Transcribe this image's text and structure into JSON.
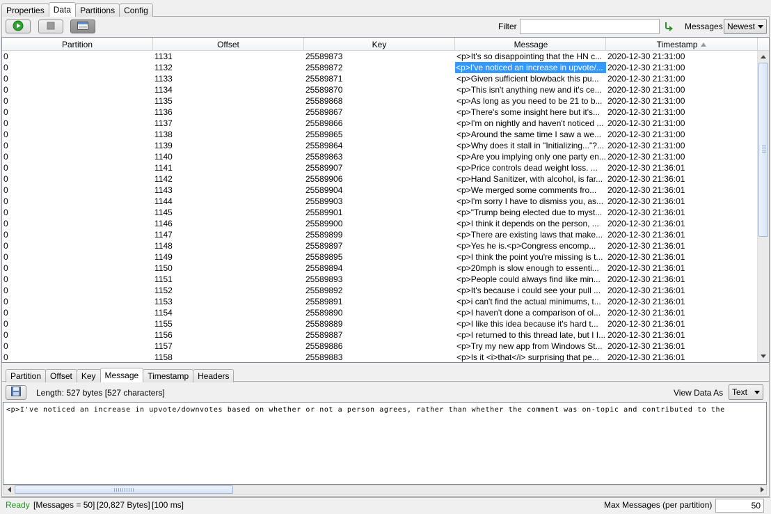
{
  "top_tabs": [
    "Properties",
    "Data",
    "Partitions",
    "Config"
  ],
  "toolbar": {
    "filter_label": "Filter",
    "filter_value": "",
    "messages_label": "Messages",
    "messages_value": "Newest"
  },
  "columns": [
    "Partition",
    "Offset",
    "Key",
    "Message",
    "Timestamp"
  ],
  "rows": [
    [
      "0",
      "1131",
      "25589873",
      "<p>It's so disappointing that the HN c...",
      "2020-12-30 21:31:00"
    ],
    [
      "0",
      "1132",
      "25589872",
      "<p>I've noticed an increase in upvote/...",
      "2020-12-30 21:31:00"
    ],
    [
      "0",
      "1133",
      "25589871",
      "<p>Given sufficient blowback this pu...",
      "2020-12-30 21:31:00"
    ],
    [
      "0",
      "1134",
      "25589870",
      "<p>This isn't anything new and it's ce...",
      "2020-12-30 21:31:00"
    ],
    [
      "0",
      "1135",
      "25589868",
      "<p>As long as you need to be 21 to b...",
      "2020-12-30 21:31:00"
    ],
    [
      "0",
      "1136",
      "25589867",
      "<p>There's some insight here but it's...",
      "2020-12-30 21:31:00"
    ],
    [
      "0",
      "1137",
      "25589866",
      "<p>I'm on nightly and haven't noticed ...",
      "2020-12-30 21:31:00"
    ],
    [
      "0",
      "1138",
      "25589865",
      "<p>Around the same time I saw a we...",
      "2020-12-30 21:31:00"
    ],
    [
      "0",
      "1139",
      "25589864",
      "<p>Why does it stall in \"Initializing...\"?...",
      "2020-12-30 21:31:00"
    ],
    [
      "0",
      "1140",
      "25589863",
      "<p>Are you implying only one party en...",
      "2020-12-30 21:31:00"
    ],
    [
      "0",
      "1141",
      "25589907",
      "<p>Price controls dead weight loss.  ...",
      "2020-12-30 21:36:01"
    ],
    [
      "0",
      "1142",
      "25589906",
      "<p>Hand Sanitizer, with alcohol, is far...",
      "2020-12-30 21:36:01"
    ],
    [
      "0",
      "1143",
      "25589904",
      "<p>We merged some comments fro...",
      "2020-12-30 21:36:01"
    ],
    [
      "0",
      "1144",
      "25589903",
      "<p>I'm sorry I have to dismiss you, as...",
      "2020-12-30 21:36:01"
    ],
    [
      "0",
      "1145",
      "25589901",
      "<p>\"Trump being elected due to myst...",
      "2020-12-30 21:36:01"
    ],
    [
      "0",
      "1146",
      "25589900",
      "<p>I think it depends on the person, ...",
      "2020-12-30 21:36:01"
    ],
    [
      "0",
      "1147",
      "25589899",
      "<p>There are existing laws that make...",
      "2020-12-30 21:36:01"
    ],
    [
      "0",
      "1148",
      "25589897",
      "<p>Yes he is.<p>Congress encomp...",
      "2020-12-30 21:36:01"
    ],
    [
      "0",
      "1149",
      "25589895",
      "<p>I think the point you're missing is t...",
      "2020-12-30 21:36:01"
    ],
    [
      "0",
      "1150",
      "25589894",
      "<p>20mph is slow enough to essenti...",
      "2020-12-30 21:36:01"
    ],
    [
      "0",
      "1151",
      "25589893",
      "<p>People could always find like min...",
      "2020-12-30 21:36:01"
    ],
    [
      "0",
      "1152",
      "25589892",
      "<p>It's because i could see your pull ...",
      "2020-12-30 21:36:01"
    ],
    [
      "0",
      "1153",
      "25589891",
      "<p>i can't find the actual minimums, t...",
      "2020-12-30 21:36:01"
    ],
    [
      "0",
      "1154",
      "25589890",
      "<p>I haven't done a comparison of ol...",
      "2020-12-30 21:36:01"
    ],
    [
      "0",
      "1155",
      "25589889",
      "<p>I like this idea because it's hard t...",
      "2020-12-30 21:36:01"
    ],
    [
      "0",
      "1156",
      "25589887",
      "<p>I returned to this thread late, but I I...",
      "2020-12-30 21:36:01"
    ],
    [
      "0",
      "1157",
      "25589886",
      "<p>Try my new app from Windows St...",
      "2020-12-30 21:36:01"
    ],
    [
      "0",
      "1158",
      "25589883",
      "<p>Is it <i>that</i> surprising that pe...",
      "2020-12-30 21:36:01"
    ]
  ],
  "selected_row": 1,
  "bottom_tabs": [
    "Partition",
    "Offset",
    "Key",
    "Message",
    "Timestamp",
    "Headers"
  ],
  "detail": {
    "length_text": "Length: 527 bytes [527 characters]",
    "view_label": "View Data As",
    "view_value": "Text",
    "content": "<p>I've noticed an increase in upvote/downvotes based on whether or not a person agrees, rather than whether the comment was on-topic and contributed to the"
  },
  "status": {
    "ready": "Ready",
    "messages": "[Messages = 50]",
    "bytes": "[20,827 Bytes]",
    "ms": "[100 ms]",
    "max_label": "Max Messages (per partition)",
    "max_value": "50"
  },
  "colors": {
    "selection": "#3399ff",
    "ready": "#1a9c1a"
  },
  "icons": [
    "play-icon",
    "stop-icon",
    "toggle-view-icon",
    "apply-filter-icon",
    "save-icon",
    "sort-ascending-icon"
  ]
}
